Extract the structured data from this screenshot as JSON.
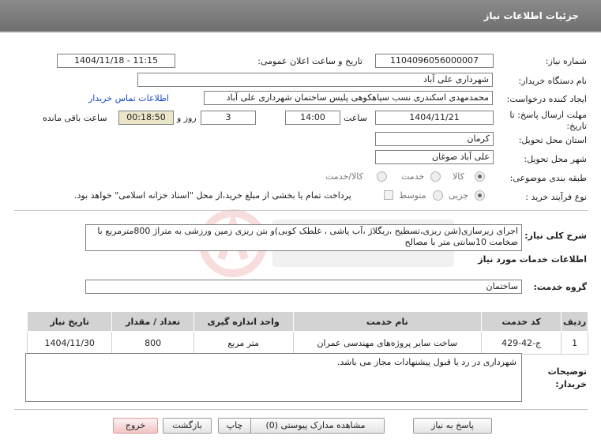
{
  "window": {
    "title": "جزئیات اطلاعات نیاز"
  },
  "form": {
    "need_number": {
      "label": "شماره نیاز:",
      "value": "1104096056000007"
    },
    "announce_datetime": {
      "label": "تاریخ و ساعت اعلان عمومی:",
      "value": "1404/11/18 - 11:15"
    },
    "buyer_org": {
      "label": "نام دستگاه خریدار:",
      "value": "شهرداری علی آباد"
    },
    "creator": {
      "label": "ایجاد کننده درخواست:",
      "value": "محمدمهدی اسکندری نسب سپاهکوهی پلیس ساختمان شهرداری علی آباد",
      "contact_link": "اطلاعات تماس خریدار"
    },
    "deadline": {
      "label": "مهلت ارسال پاسخ: تا تاریخ:",
      "date": "1404/11/21",
      "time_label": "ساعت",
      "time": "14:00",
      "days": "3",
      "days_label": "روز و",
      "remaining": "00:18:50",
      "remaining_label": "ساعت باقی مانده"
    },
    "province": {
      "label": "استان محل تحویل:",
      "value": "کرمان"
    },
    "city": {
      "label": "شهر محل تحویل:",
      "value": "علی آباد صوغان"
    },
    "category": {
      "label": "طبقه بندی موضوعی:",
      "options": [
        "کالا",
        "خدمت",
        "کالا/خدمت"
      ],
      "selected": "خدمت"
    },
    "purchase_type": {
      "label": "نوع فرآیند خرید :",
      "options": [
        "جزیی",
        "متوسط"
      ],
      "selected": "جزیی",
      "note": "پرداخت تمام یا بخشی از مبلغ خرید،از محل \"اسناد خزانه اسلامی\" خواهد بود."
    }
  },
  "description": {
    "label": "شرح کلی نیاز:",
    "text": "اجرای زیرسازی(شن ریزی،تسطیح ،ریگلاژ ،آب پاشی ، غلطک کوبی)و بتن ریزی زمین ورزشی به متراژ 800مترمربع با ضخامت 10سانتی متر با مصالح"
  },
  "services": {
    "section_title": "اطلاعات خدمات مورد نیاز",
    "group_label": "گروه خدمت:",
    "group_value": "ساختمان",
    "columns": [
      "ردیف",
      "کد خدمت",
      "نام خدمت",
      "واحد اندازه گیری",
      "تعداد / مقدار",
      "تاریخ نیاز"
    ],
    "rows": [
      {
        "row": "1",
        "code": "ج-42-429",
        "name": "ساخت سایر پروژه‌های مهندسی عمران",
        "unit": "متر مربع",
        "qty": "800",
        "date": "1404/11/30"
      }
    ]
  },
  "buyer_notes": {
    "label": "توضیحات خریدار:",
    "text": "شهرداری در رد یا قبول پیشنهادات مجاز می باشد."
  },
  "buttons": {
    "reply": "پاسخ به نیاز",
    "attachments": "مشاهده مدارک پیوستی (0)",
    "print": "چاپ",
    "back": "بازگشت",
    "exit": "خروج"
  },
  "colors": {
    "titlebar": "#7a7a7a",
    "link": "#1a49c8",
    "remaining_bg": "#ebe6c8",
    "exit_btn": "#f2c4c4"
  }
}
